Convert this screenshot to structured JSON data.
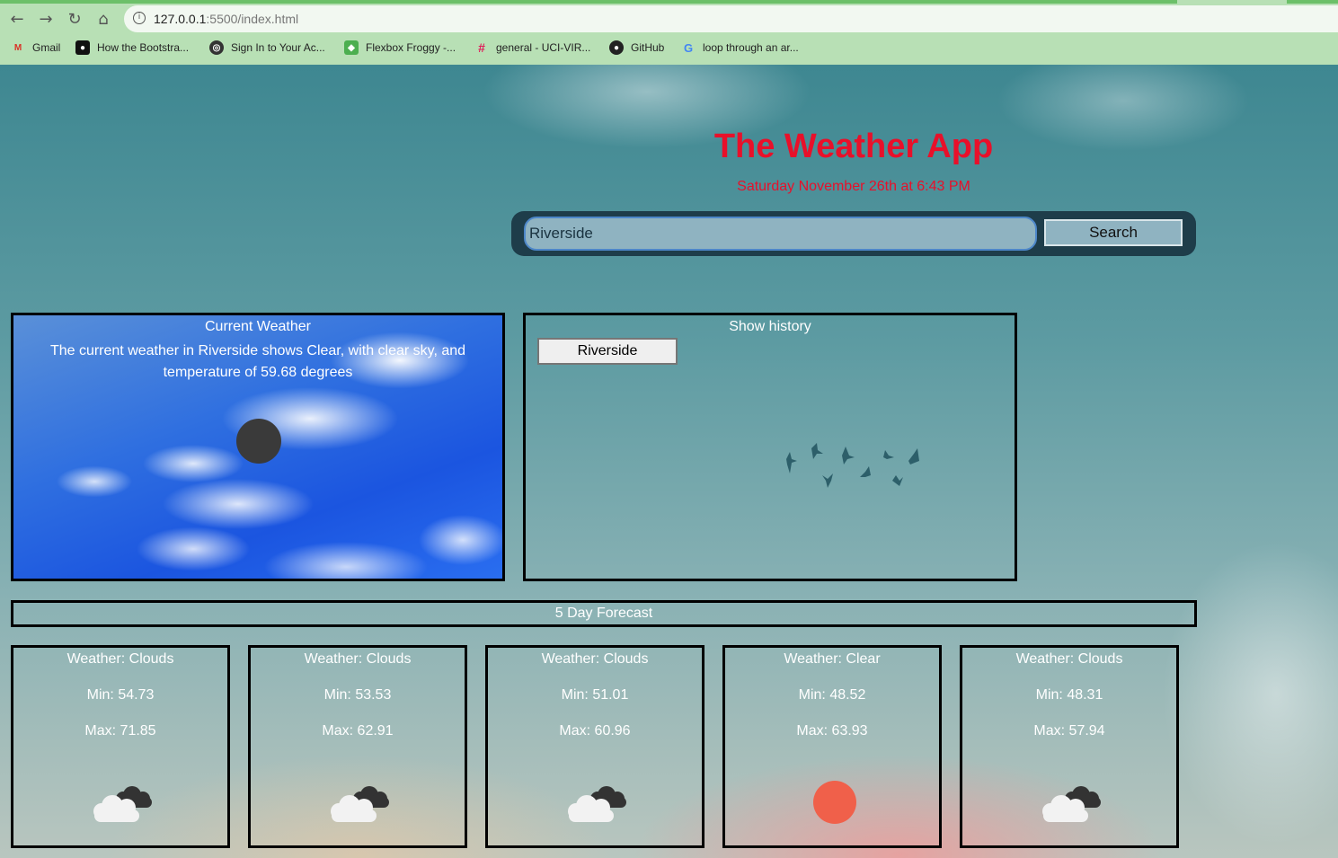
{
  "browser": {
    "url_host": "127.0.0.1",
    "url_path": ":5500/index.html",
    "bookmarks": [
      {
        "label": "Gmail",
        "icon": "gmail-icon"
      },
      {
        "label": "How the Bootstra...",
        "icon": "medium-icon"
      },
      {
        "label": "Sign In to Your Ac...",
        "icon": "globe-icon"
      },
      {
        "label": "Flexbox Froggy -...",
        "icon": "frog-icon"
      },
      {
        "label": "general - UCI-VIR...",
        "icon": "slack-icon"
      },
      {
        "label": "GitHub",
        "icon": "github-icon"
      },
      {
        "label": "loop through an ar...",
        "icon": "google-icon"
      }
    ]
  },
  "header": {
    "title": "The Weather App",
    "date": "Saturday November 26th at 6:43 PM"
  },
  "search": {
    "value": "Riverside",
    "button_label": "Search"
  },
  "current": {
    "title": "Current Weather",
    "description": "The current weather in Riverside shows Clear, with clear sky, and temperature of 59.68 degrees",
    "icon": "moon-icon",
    "icon_color": "#3a3a3a"
  },
  "history": {
    "title": "Show history",
    "items": [
      "Riverside"
    ]
  },
  "forecast": {
    "heading": "5 Day Forecast",
    "days": [
      {
        "weather": "Weather: Clouds",
        "min": "Min: 54.73",
        "max": "Max: 71.85",
        "icon": "clouds-icon"
      },
      {
        "weather": "Weather: Clouds",
        "min": "Min: 53.53",
        "max": "Max: 62.91",
        "icon": "clouds-icon"
      },
      {
        "weather": "Weather: Clouds",
        "min": "Min: 51.01",
        "max": "Max: 60.96",
        "icon": "clouds-icon"
      },
      {
        "weather": "Weather: Clear",
        "min": "Min: 48.52",
        "max": "Max: 63.93",
        "icon": "sun-icon"
      },
      {
        "weather": "Weather: Clouds",
        "min": "Min: 48.31",
        "max": "Max: 57.94",
        "icon": "clouds-icon"
      }
    ]
  },
  "colors": {
    "title_red": "#e8102a",
    "sun": "#f0604a",
    "search_bg": "#1e3d4a"
  }
}
